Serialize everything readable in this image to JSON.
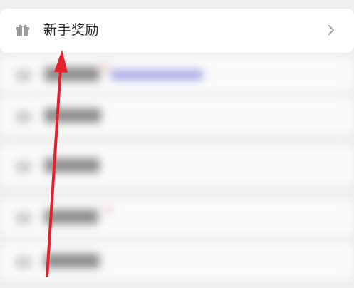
{
  "menu_item": {
    "label": "新手奖励",
    "icon": "gift-icon",
    "chevron": "chevron-right-icon"
  },
  "colors": {
    "background": "#efefef",
    "card": "#ffffff",
    "text": "#2b2b2b",
    "icon": "#9a9a9a",
    "annotation_arrow": "#e5222b"
  }
}
